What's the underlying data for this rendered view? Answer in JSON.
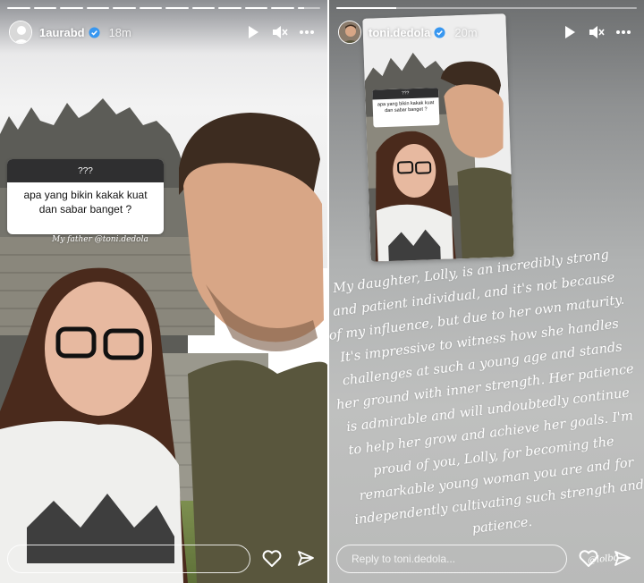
{
  "left_story": {
    "progress": {
      "segments": 12,
      "active_index": 11
    },
    "header": {
      "username": "1aurabd",
      "time": "18m"
    },
    "question_sticker": {
      "header": "???",
      "question": "apa yang bikin kakak kuat dan sabar banget ?"
    },
    "caption": "My father @toni.dedola",
    "footer": {
      "reply_placeholder": ""
    }
  },
  "right_story": {
    "progress": {
      "segments": 1,
      "active_index": 0
    },
    "header": {
      "username": "toni.dedola",
      "time": "20m"
    },
    "repost": {
      "question_header": "???",
      "question": "apa yang bikin kakak kuat dan sabar banget ?"
    },
    "quote": "My daughter, Lolly, is an incredibly strong and patient individual, and it's not because of my influence, but due to her own maturity. It's impressive to witness how she handles challenges at such a young age and stands her ground with inner strength. Her patience is admirable and will undoubtedly continue to help her grow and achieve her goals. I'm proud of you, Lolly, for becoming the remarkable young woman you are and for independently cultivating such strength and patience.",
    "signature": "@lolbd",
    "footer": {
      "reply_placeholder": "Reply to toni.dedola..."
    }
  },
  "icons": {
    "play": "play-icon",
    "mute": "mute-icon",
    "more": "more-icon",
    "like": "heart-icon",
    "share": "send-icon"
  },
  "colors": {
    "verified": "#3897f0",
    "sticker_header": "#2f2f30"
  }
}
